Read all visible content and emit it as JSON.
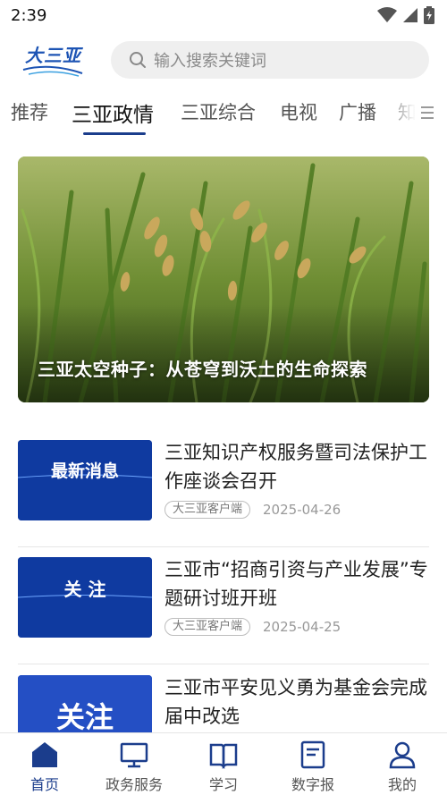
{
  "status_bar": {
    "time": "2:39"
  },
  "header": {
    "logo_text": "大三亚",
    "search": {
      "placeholder": "输入搜索关键词"
    }
  },
  "tabs": [
    {
      "label": "推荐",
      "active": false
    },
    {
      "label": "三亚政情",
      "active": true
    },
    {
      "label": "三亚综合",
      "active": false
    },
    {
      "label": "电视",
      "active": false
    },
    {
      "label": "广播",
      "active": false
    },
    {
      "label": "知",
      "active": false
    }
  ],
  "hero": {
    "caption": "三亚太空种子：从苍穹到沃土的生命探索"
  },
  "news": [
    {
      "thumb_label": "最新消息",
      "title": "三亚知识产权服务暨司法保护工作座谈会召开",
      "source": "大三亚客户端",
      "date": "2025-04-26"
    },
    {
      "thumb_label": "关 注",
      "title": "三亚市“招商引资与产业发展”专题研讨班开班",
      "source": "大三亚客户端",
      "date": "2025-04-25"
    },
    {
      "thumb_label": "关注",
      "title": "三亚市平安见义勇为基金会完成届中改选",
      "source": "",
      "date": ""
    }
  ],
  "bottom_nav": [
    {
      "label": "首页",
      "icon": "home-icon",
      "active": true
    },
    {
      "label": "政务服务",
      "icon": "monitor-icon",
      "active": false
    },
    {
      "label": "学习",
      "icon": "book-icon",
      "active": false
    },
    {
      "label": "数字报",
      "icon": "newspaper-icon",
      "active": false
    },
    {
      "label": "我的",
      "icon": "user-icon",
      "active": false
    }
  ],
  "colors": {
    "accent": "#1b3d8c",
    "thumb_blue": "#0f3aa0"
  }
}
